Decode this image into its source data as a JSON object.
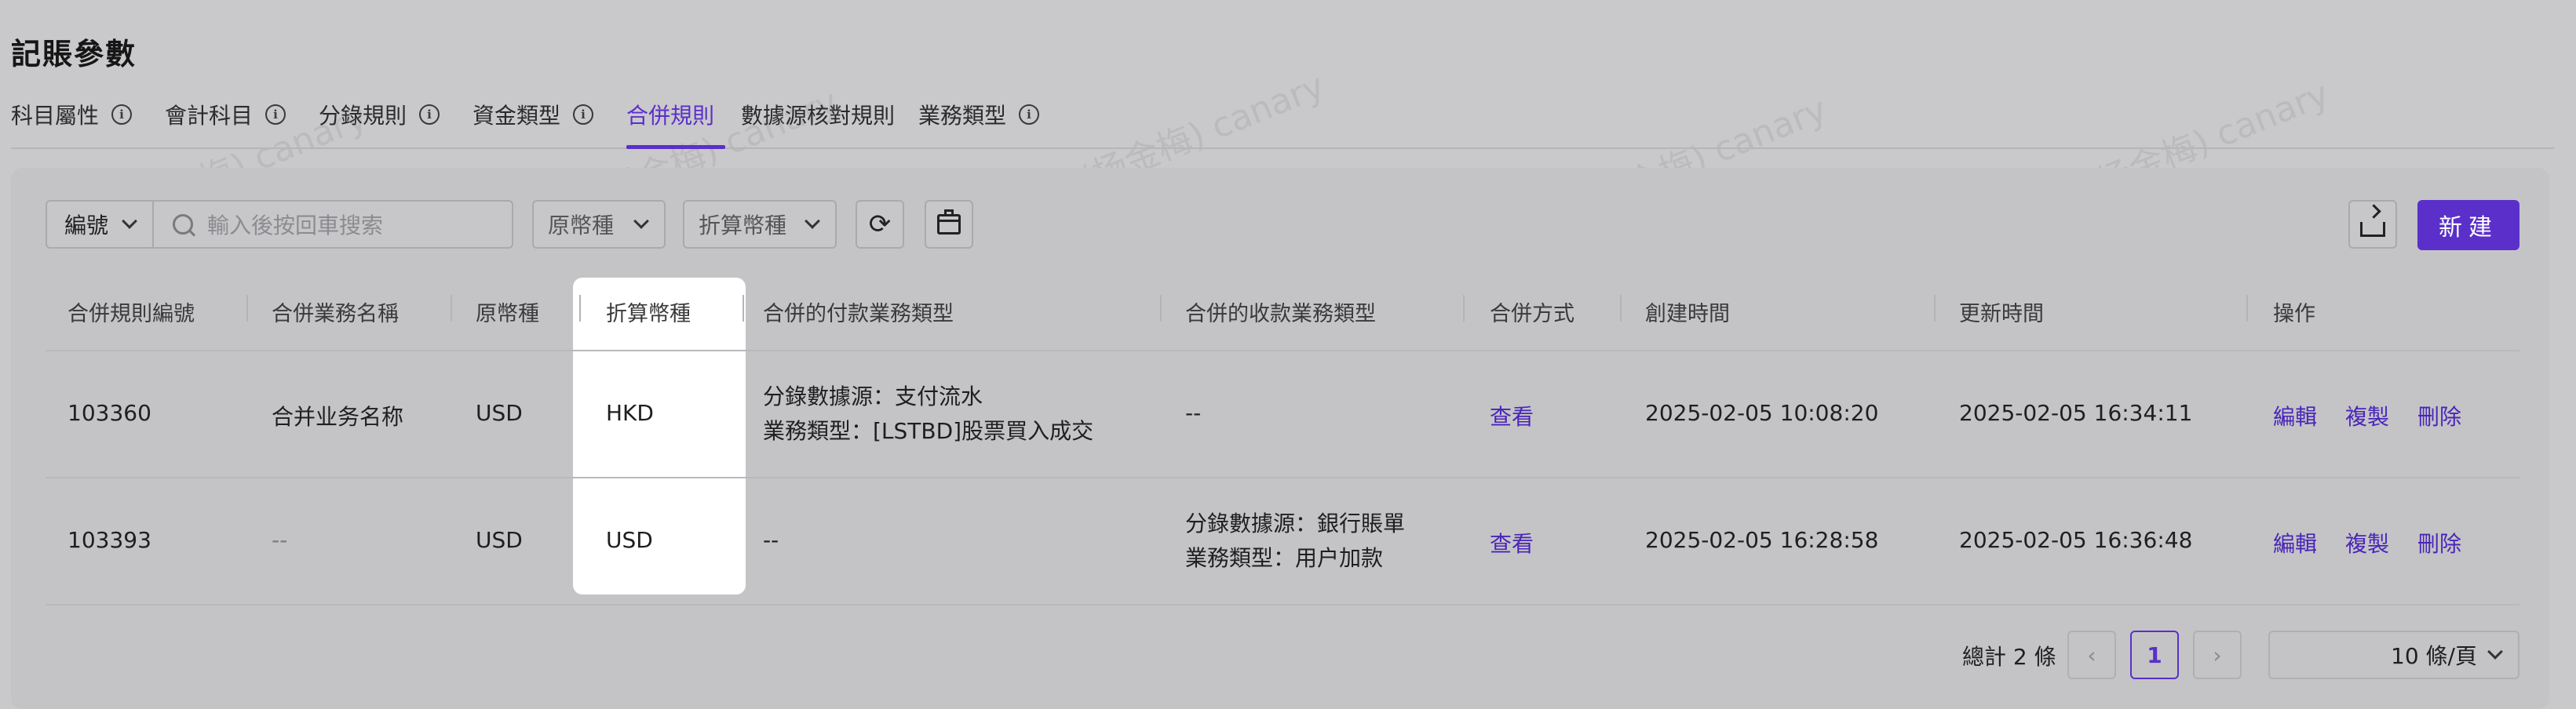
{
  "page": {
    "title": "記賬參數"
  },
  "tabs": [
    {
      "label": "科目屬性",
      "has_info": true
    },
    {
      "label": "會計科目",
      "has_info": true
    },
    {
      "label": "分錄規則",
      "has_info": true
    },
    {
      "label": "資金類型",
      "has_info": true
    },
    {
      "label": "合併規則",
      "has_info": false,
      "active": true
    },
    {
      "label": "數據源核對規則",
      "has_info": false
    },
    {
      "label": "業務類型",
      "has_info": true
    }
  ],
  "toolbar": {
    "field_select": "編號",
    "search_placeholder": "輸入後按回車搜索",
    "filter_original_currency": "原幣種",
    "filter_converted_currency": "折算幣種",
    "new_button": "新建"
  },
  "table": {
    "headers": [
      "合併規則編號",
      "合併業務名稱",
      "原幣種",
      "折算幣種",
      "合併的付款業務類型",
      "合併的收款業務類型",
      "合併方式",
      "創建時間",
      "更新時間",
      "操作"
    ],
    "rows": [
      {
        "id": "103360",
        "name": "合并业务名称",
        "original_currency": "USD",
        "converted_currency": "HKD",
        "payment_line1": "分錄數據源：支付流水",
        "payment_line2": "業務類型：[LSTBD]股票買入成交",
        "receipt_line1": "--",
        "receipt_line2": "",
        "merge_method": "查看",
        "created": "2025-02-05 10:08:20",
        "updated": "2025-02-05 16:34:11",
        "actions": [
          "編輯",
          "複製",
          "刪除"
        ]
      },
      {
        "id": "103393",
        "name": "--",
        "original_currency": "USD",
        "converted_currency": "USD",
        "payment_line1": "--",
        "payment_line2": "",
        "receipt_line1": "分錄數據源：銀行賬單",
        "receipt_line2": "業務類型：用户加款",
        "merge_method": "查看",
        "created": "2025-02-05 16:28:58",
        "updated": "2025-02-05 16:36:48",
        "actions": [
          "編輯",
          "複製",
          "刪除"
        ]
      }
    ]
  },
  "pagination": {
    "total": "總計 2 條",
    "current_page": "1",
    "page_size": "10 條/頁"
  },
  "watermark": "芳秋(杨金梅) canary",
  "colors": {
    "accent": "#5b2fc9",
    "link": "#4a25b8",
    "overlay_bg": "#c9c9cc"
  }
}
